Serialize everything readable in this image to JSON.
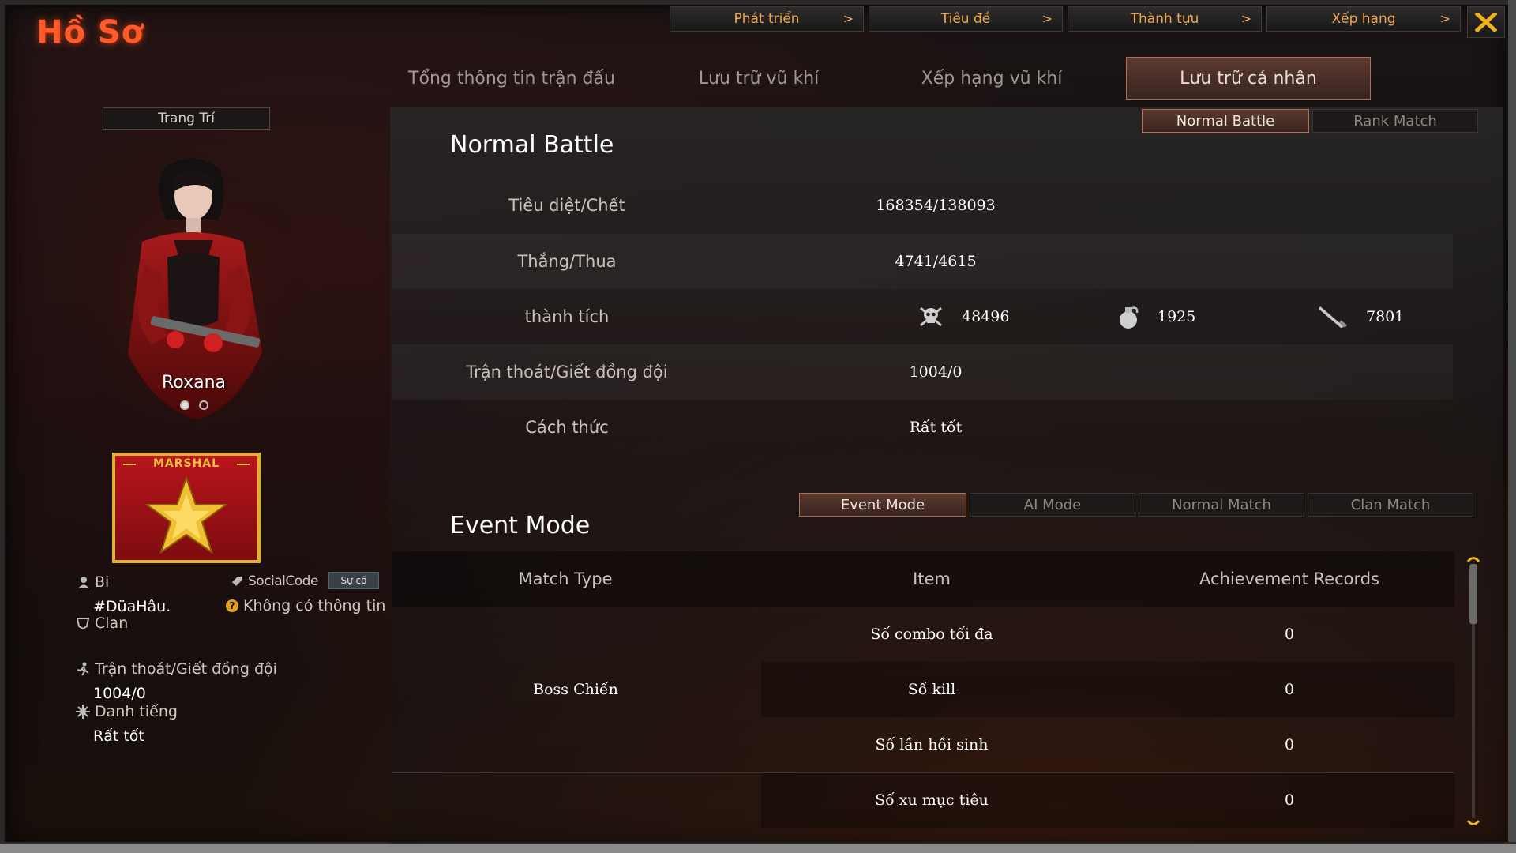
{
  "app": {
    "title": "Hồ Sơ"
  },
  "top_menu": [
    {
      "label": "Phát triển"
    },
    {
      "label": "Tiêu đề"
    },
    {
      "label": "Thành tựu"
    },
    {
      "label": "Xếp hạng"
    }
  ],
  "main_tabs": [
    {
      "label": "Tổng thông tin trận đấu",
      "active": false
    },
    {
      "label": "Lưu trữ vũ khí",
      "active": false
    },
    {
      "label": "Xếp hạng vũ khí",
      "active": false
    },
    {
      "label": "Lưu trữ cá nhân",
      "active": true
    }
  ],
  "profile": {
    "decor_button": "Trang Trí",
    "character_name": "Roxana",
    "carousel_page": 1,
    "carousel_total": 2,
    "rank_label": "MARSHAL",
    "name_label": "Bi",
    "player_name": "#DüaHâu.",
    "social_label": "SocialCode",
    "social_button": "Sự cố",
    "social_info": "Không có thông tin",
    "clan_label": "Clan",
    "desert_label": "Trận thoát/Giết đồng đội",
    "desert_value": "1004/0",
    "reputation_label": "Danh tiếng",
    "reputation_value": "Rất tốt"
  },
  "battle_modes": [
    {
      "label": "Normal Battle",
      "active": true
    },
    {
      "label": "Rank Match",
      "active": false
    }
  ],
  "normal_battle": {
    "title": "Normal Battle",
    "rows": [
      {
        "label": "Tiêu diệt/Chết",
        "value": "168354/138093"
      },
      {
        "label": "Thắng/Thua",
        "value": "4741/4615"
      },
      {
        "label": "thành tích",
        "value": ""
      },
      {
        "label": "Trận thoát/Giết đồng đội",
        "value": "1004/0"
      },
      {
        "label": "Cách thức",
        "value": "Rất tốt"
      }
    ],
    "achievements": [
      {
        "icon": "skull-crossbones-icon",
        "value": "48496"
      },
      {
        "icon": "grenade-icon",
        "value": "1925"
      },
      {
        "icon": "knife-icon",
        "value": "7801"
      }
    ]
  },
  "event_modes": [
    {
      "label": "Event Mode",
      "active": true
    },
    {
      "label": "AI Mode",
      "active": false
    },
    {
      "label": "Normal Match",
      "active": false
    },
    {
      "label": "Clan Match",
      "active": false
    }
  ],
  "event_mode": {
    "title": "Event Mode",
    "headers": [
      "Match Type",
      "Item",
      "Achievement Records"
    ],
    "match_type": "Boss Chiến",
    "rows": [
      {
        "item": "Số combo tối đa",
        "value": "0"
      },
      {
        "item": "Số kill",
        "value": "0"
      },
      {
        "item": "Số lần hồi sinh",
        "value": "0"
      },
      {
        "item": "Số xu mục tiêu",
        "value": "0"
      }
    ]
  },
  "colors": {
    "title": "#ff5a2a",
    "menu_text": "#f0a84a",
    "active_tab_border": "#b07050",
    "close_icon": "#f2b21a",
    "rank_badge": "#b8151a",
    "rank_border": "#e0b030"
  }
}
